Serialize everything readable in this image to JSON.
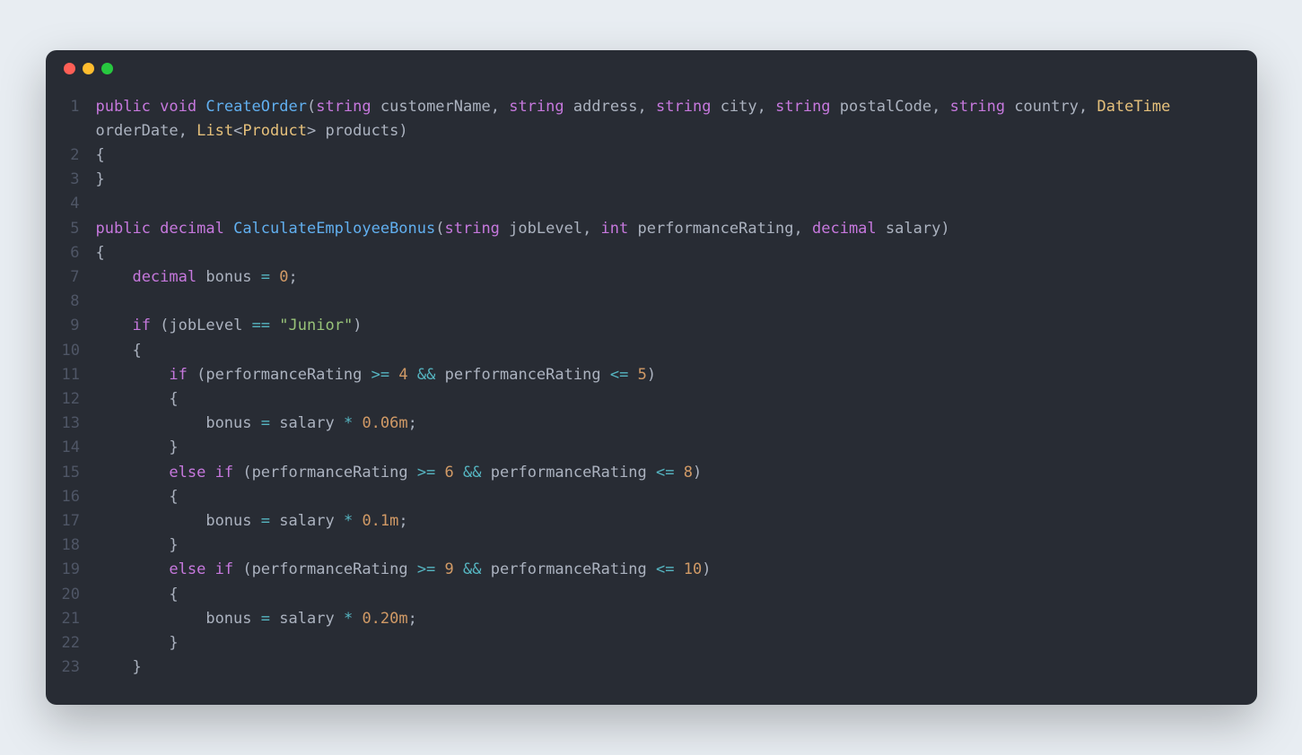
{
  "colors": {
    "background_page": "#e8edf2",
    "background_window": "#282c34",
    "dot_red": "#ff5f56",
    "dot_yellow": "#ffbd2e",
    "dot_green": "#27c93f",
    "line_number": "#4f5666",
    "default_text": "#abb2bf",
    "keyword": "#c678dd",
    "function": "#61afef",
    "class": "#e5c07b",
    "string": "#98c379",
    "number": "#d19a66",
    "operator": "#56b6c2"
  },
  "lines": [
    {
      "num": "1",
      "wrap": true,
      "tokens": [
        {
          "c": "k",
          "t": "public"
        },
        {
          "c": "p",
          "t": " "
        },
        {
          "c": "k",
          "t": "void"
        },
        {
          "c": "p",
          "t": " "
        },
        {
          "c": "fn",
          "t": "CreateOrder"
        },
        {
          "c": "p",
          "t": "("
        },
        {
          "c": "t",
          "t": "string"
        },
        {
          "c": "p",
          "t": " "
        },
        {
          "c": "v",
          "t": "customerName"
        },
        {
          "c": "p",
          "t": ", "
        },
        {
          "c": "t",
          "t": "string"
        },
        {
          "c": "p",
          "t": " "
        },
        {
          "c": "v",
          "t": "address"
        },
        {
          "c": "p",
          "t": ", "
        },
        {
          "c": "t",
          "t": "string"
        },
        {
          "c": "p",
          "t": " "
        },
        {
          "c": "v",
          "t": "city"
        },
        {
          "c": "p",
          "t": ", "
        },
        {
          "c": "t",
          "t": "string"
        },
        {
          "c": "p",
          "t": " "
        },
        {
          "c": "v",
          "t": "postalCode"
        },
        {
          "c": "p",
          "t": ", "
        },
        {
          "c": "t",
          "t": "string"
        },
        {
          "c": "p",
          "t": " "
        },
        {
          "c": "v",
          "t": "country"
        },
        {
          "c": "p",
          "t": ", "
        },
        {
          "c": "cl",
          "t": "DateTime"
        },
        {
          "c": "p",
          "t": " "
        },
        {
          "c": "v",
          "t": "orderDate"
        },
        {
          "c": "p",
          "t": ", "
        },
        {
          "c": "cl",
          "t": "List"
        },
        {
          "c": "p",
          "t": "<"
        },
        {
          "c": "cl",
          "t": "Product"
        },
        {
          "c": "p",
          "t": "> "
        },
        {
          "c": "v",
          "t": "products"
        },
        {
          "c": "p",
          "t": ")"
        }
      ]
    },
    {
      "num": "2",
      "tokens": [
        {
          "c": "p",
          "t": "{"
        }
      ]
    },
    {
      "num": "3",
      "tokens": [
        {
          "c": "p",
          "t": "}"
        }
      ]
    },
    {
      "num": "4",
      "tokens": []
    },
    {
      "num": "5",
      "tokens": [
        {
          "c": "k",
          "t": "public"
        },
        {
          "c": "p",
          "t": " "
        },
        {
          "c": "t",
          "t": "decimal"
        },
        {
          "c": "p",
          "t": " "
        },
        {
          "c": "fn",
          "t": "CalculateEmployeeBonus"
        },
        {
          "c": "p",
          "t": "("
        },
        {
          "c": "t",
          "t": "string"
        },
        {
          "c": "p",
          "t": " "
        },
        {
          "c": "v",
          "t": "jobLevel"
        },
        {
          "c": "p",
          "t": ", "
        },
        {
          "c": "t",
          "t": "int"
        },
        {
          "c": "p",
          "t": " "
        },
        {
          "c": "v",
          "t": "performanceRating"
        },
        {
          "c": "p",
          "t": ", "
        },
        {
          "c": "t",
          "t": "decimal"
        },
        {
          "c": "p",
          "t": " "
        },
        {
          "c": "v",
          "t": "salary"
        },
        {
          "c": "p",
          "t": ")"
        }
      ]
    },
    {
      "num": "6",
      "tokens": [
        {
          "c": "p",
          "t": "{"
        }
      ]
    },
    {
      "num": "7",
      "tokens": [
        {
          "c": "p",
          "t": "    "
        },
        {
          "c": "t",
          "t": "decimal"
        },
        {
          "c": "p",
          "t": " "
        },
        {
          "c": "v",
          "t": "bonus"
        },
        {
          "c": "p",
          "t": " "
        },
        {
          "c": "op",
          "t": "="
        },
        {
          "c": "p",
          "t": " "
        },
        {
          "c": "n",
          "t": "0"
        },
        {
          "c": "p",
          "t": ";"
        }
      ]
    },
    {
      "num": "8",
      "tokens": []
    },
    {
      "num": "9",
      "tokens": [
        {
          "c": "p",
          "t": "    "
        },
        {
          "c": "k",
          "t": "if"
        },
        {
          "c": "p",
          "t": " ("
        },
        {
          "c": "v",
          "t": "jobLevel"
        },
        {
          "c": "p",
          "t": " "
        },
        {
          "c": "op",
          "t": "=="
        },
        {
          "c": "p",
          "t": " "
        },
        {
          "c": "s",
          "t": "\"Junior\""
        },
        {
          "c": "p",
          "t": ")"
        }
      ]
    },
    {
      "num": "10",
      "tokens": [
        {
          "c": "p",
          "t": "    {"
        }
      ]
    },
    {
      "num": "11",
      "tokens": [
        {
          "c": "p",
          "t": "        "
        },
        {
          "c": "k",
          "t": "if"
        },
        {
          "c": "p",
          "t": " ("
        },
        {
          "c": "v",
          "t": "performanceRating"
        },
        {
          "c": "p",
          "t": " "
        },
        {
          "c": "op",
          "t": ">="
        },
        {
          "c": "p",
          "t": " "
        },
        {
          "c": "n",
          "t": "4"
        },
        {
          "c": "p",
          "t": " "
        },
        {
          "c": "op",
          "t": "&&"
        },
        {
          "c": "p",
          "t": " "
        },
        {
          "c": "v",
          "t": "performanceRating"
        },
        {
          "c": "p",
          "t": " "
        },
        {
          "c": "op",
          "t": "<="
        },
        {
          "c": "p",
          "t": " "
        },
        {
          "c": "n",
          "t": "5"
        },
        {
          "c": "p",
          "t": ")"
        }
      ]
    },
    {
      "num": "12",
      "tokens": [
        {
          "c": "p",
          "t": "        {"
        }
      ]
    },
    {
      "num": "13",
      "tokens": [
        {
          "c": "p",
          "t": "            "
        },
        {
          "c": "v",
          "t": "bonus"
        },
        {
          "c": "p",
          "t": " "
        },
        {
          "c": "op",
          "t": "="
        },
        {
          "c": "p",
          "t": " "
        },
        {
          "c": "v",
          "t": "salary"
        },
        {
          "c": "p",
          "t": " "
        },
        {
          "c": "op",
          "t": "*"
        },
        {
          "c": "p",
          "t": " "
        },
        {
          "c": "n",
          "t": "0.06m"
        },
        {
          "c": "p",
          "t": ";"
        }
      ]
    },
    {
      "num": "14",
      "tokens": [
        {
          "c": "p",
          "t": "        }"
        }
      ]
    },
    {
      "num": "15",
      "tokens": [
        {
          "c": "p",
          "t": "        "
        },
        {
          "c": "k",
          "t": "else"
        },
        {
          "c": "p",
          "t": " "
        },
        {
          "c": "k",
          "t": "if"
        },
        {
          "c": "p",
          "t": " ("
        },
        {
          "c": "v",
          "t": "performanceRating"
        },
        {
          "c": "p",
          "t": " "
        },
        {
          "c": "op",
          "t": ">="
        },
        {
          "c": "p",
          "t": " "
        },
        {
          "c": "n",
          "t": "6"
        },
        {
          "c": "p",
          "t": " "
        },
        {
          "c": "op",
          "t": "&&"
        },
        {
          "c": "p",
          "t": " "
        },
        {
          "c": "v",
          "t": "performanceRating"
        },
        {
          "c": "p",
          "t": " "
        },
        {
          "c": "op",
          "t": "<="
        },
        {
          "c": "p",
          "t": " "
        },
        {
          "c": "n",
          "t": "8"
        },
        {
          "c": "p",
          "t": ")"
        }
      ]
    },
    {
      "num": "16",
      "tokens": [
        {
          "c": "p",
          "t": "        {"
        }
      ]
    },
    {
      "num": "17",
      "tokens": [
        {
          "c": "p",
          "t": "            "
        },
        {
          "c": "v",
          "t": "bonus"
        },
        {
          "c": "p",
          "t": " "
        },
        {
          "c": "op",
          "t": "="
        },
        {
          "c": "p",
          "t": " "
        },
        {
          "c": "v",
          "t": "salary"
        },
        {
          "c": "p",
          "t": " "
        },
        {
          "c": "op",
          "t": "*"
        },
        {
          "c": "p",
          "t": " "
        },
        {
          "c": "n",
          "t": "0.1m"
        },
        {
          "c": "p",
          "t": ";"
        }
      ]
    },
    {
      "num": "18",
      "tokens": [
        {
          "c": "p",
          "t": "        }"
        }
      ]
    },
    {
      "num": "19",
      "tokens": [
        {
          "c": "p",
          "t": "        "
        },
        {
          "c": "k",
          "t": "else"
        },
        {
          "c": "p",
          "t": " "
        },
        {
          "c": "k",
          "t": "if"
        },
        {
          "c": "p",
          "t": " ("
        },
        {
          "c": "v",
          "t": "performanceRating"
        },
        {
          "c": "p",
          "t": " "
        },
        {
          "c": "op",
          "t": ">="
        },
        {
          "c": "p",
          "t": " "
        },
        {
          "c": "n",
          "t": "9"
        },
        {
          "c": "p",
          "t": " "
        },
        {
          "c": "op",
          "t": "&&"
        },
        {
          "c": "p",
          "t": " "
        },
        {
          "c": "v",
          "t": "performanceRating"
        },
        {
          "c": "p",
          "t": " "
        },
        {
          "c": "op",
          "t": "<="
        },
        {
          "c": "p",
          "t": " "
        },
        {
          "c": "n",
          "t": "10"
        },
        {
          "c": "p",
          "t": ")"
        }
      ]
    },
    {
      "num": "20",
      "tokens": [
        {
          "c": "p",
          "t": "        {"
        }
      ]
    },
    {
      "num": "21",
      "tokens": [
        {
          "c": "p",
          "t": "            "
        },
        {
          "c": "v",
          "t": "bonus"
        },
        {
          "c": "p",
          "t": " "
        },
        {
          "c": "op",
          "t": "="
        },
        {
          "c": "p",
          "t": " "
        },
        {
          "c": "v",
          "t": "salary"
        },
        {
          "c": "p",
          "t": " "
        },
        {
          "c": "op",
          "t": "*"
        },
        {
          "c": "p",
          "t": " "
        },
        {
          "c": "n",
          "t": "0.20m"
        },
        {
          "c": "p",
          "t": ";"
        }
      ]
    },
    {
      "num": "22",
      "tokens": [
        {
          "c": "p",
          "t": "        }"
        }
      ]
    },
    {
      "num": "23",
      "tokens": [
        {
          "c": "p",
          "t": "    }"
        }
      ]
    }
  ]
}
